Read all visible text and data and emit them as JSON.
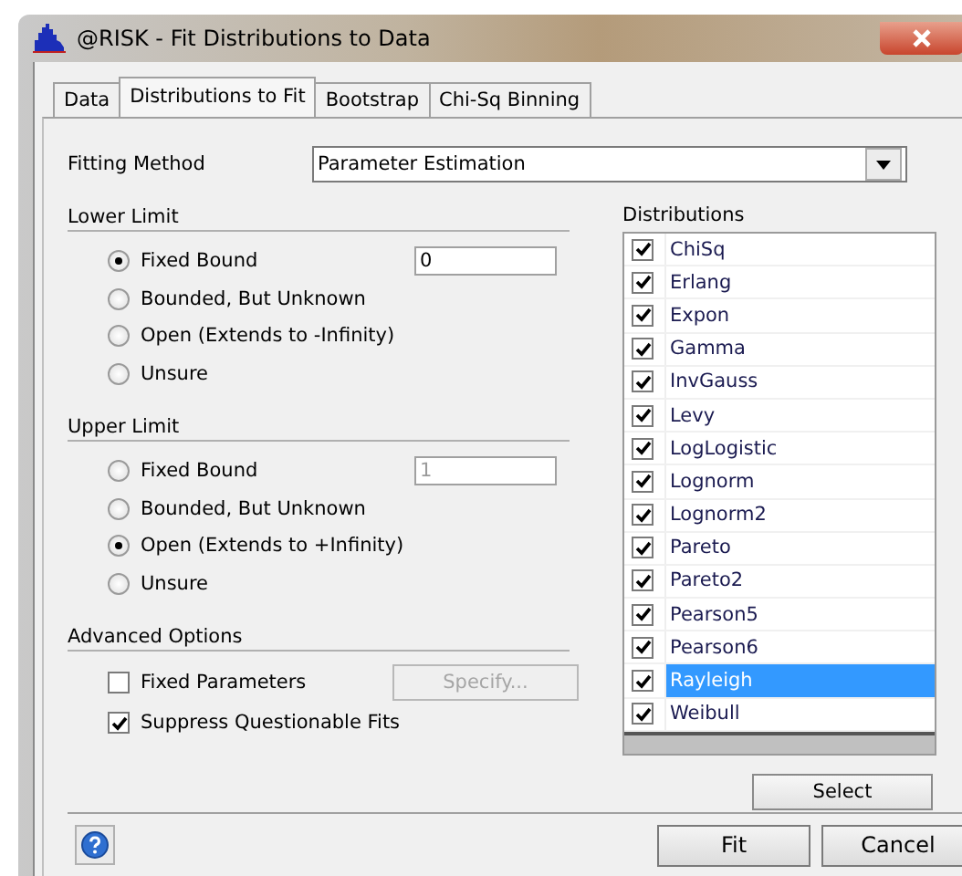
{
  "window": {
    "title": "@RISK - Fit Distributions to Data"
  },
  "tabs": [
    {
      "label": "Data",
      "selected": false
    },
    {
      "label": "Distributions to Fit",
      "selected": true
    },
    {
      "label": "Bootstrap",
      "selected": false
    },
    {
      "label": "Chi-Sq Binning",
      "selected": false
    }
  ],
  "fitting_method": {
    "label": "Fitting Method",
    "value": "Parameter Estimation"
  },
  "lower_limit": {
    "title": "Lower Limit",
    "options": [
      {
        "label": "Fixed Bound",
        "selected": true,
        "field": {
          "value": "0",
          "disabled": false
        }
      },
      {
        "label": "Bounded, But Unknown",
        "selected": false
      },
      {
        "label": "Open (Extends to -Infinity)",
        "selected": false
      },
      {
        "label": "Unsure",
        "selected": false
      }
    ]
  },
  "upper_limit": {
    "title": "Upper Limit",
    "options": [
      {
        "label": "Fixed Bound",
        "selected": false,
        "field": {
          "value": "1",
          "disabled": true
        }
      },
      {
        "label": "Bounded, But Unknown",
        "selected": false
      },
      {
        "label": "Open (Extends to +Infinity)",
        "selected": true
      },
      {
        "label": "Unsure",
        "selected": false
      }
    ]
  },
  "advanced_options": {
    "title": "Advanced Options",
    "options": [
      {
        "label": "Fixed Parameters",
        "checked": false,
        "button": {
          "label": "Specify...",
          "disabled": true
        }
      },
      {
        "label": "Suppress Questionable Fits",
        "checked": true
      }
    ]
  },
  "distributions": {
    "title": "Distributions",
    "items": [
      {
        "label": "ChiSq",
        "checked": true,
        "selected": false
      },
      {
        "label": "Erlang",
        "checked": true,
        "selected": false
      },
      {
        "label": "Expon",
        "checked": true,
        "selected": false
      },
      {
        "label": "Gamma",
        "checked": true,
        "selected": false
      },
      {
        "label": "InvGauss",
        "checked": true,
        "selected": false
      },
      {
        "label": "Levy",
        "checked": true,
        "selected": false
      },
      {
        "label": "LogLogistic",
        "checked": true,
        "selected": false
      },
      {
        "label": "Lognorm",
        "checked": true,
        "selected": false
      },
      {
        "label": "Lognorm2",
        "checked": true,
        "selected": false
      },
      {
        "label": "Pareto",
        "checked": true,
        "selected": false
      },
      {
        "label": "Pareto2",
        "checked": true,
        "selected": false
      },
      {
        "label": "Pearson5",
        "checked": true,
        "selected": false
      },
      {
        "label": "Pearson6",
        "checked": true,
        "selected": false
      },
      {
        "label": "Rayleigh",
        "checked": true,
        "selected": true
      },
      {
        "label": "Weibull",
        "checked": true,
        "selected": false
      }
    ],
    "button": "Select"
  },
  "footer_buttons": [
    "Fit",
    "Cancel"
  ]
}
